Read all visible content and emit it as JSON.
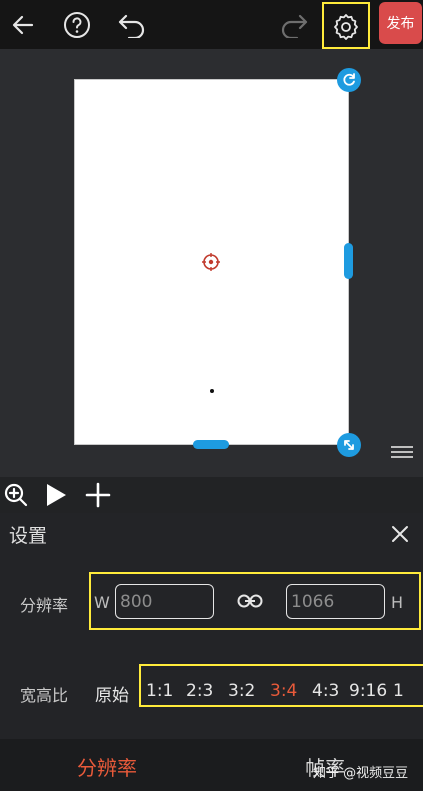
{
  "topbar": {
    "publish_label": "发布"
  },
  "panel": {
    "title": "设置",
    "resolution": {
      "label": "分辨率",
      "w_prefix": "W",
      "width_value": "800",
      "height_value": "1066",
      "h_suffix": "H"
    },
    "aspect": {
      "label": "宽高比",
      "options": [
        "原始",
        "1:1",
        "2:3",
        "3:2",
        "3:4",
        "4:3",
        "9:16",
        "1"
      ],
      "selected": "3:4"
    }
  },
  "bottom_tabs": {
    "tabs": [
      "分辨率",
      "帧率"
    ],
    "active": "分辨率"
  },
  "watermark": "知乎 @视频豆豆",
  "colors": {
    "accent_red": "#d94b4b",
    "selected_orange": "#e85a3a",
    "handle_blue": "#1e9be0",
    "highlight_yellow": "#ffeb3b"
  },
  "icons": [
    "back-arrow-icon",
    "help-icon",
    "undo-icon",
    "redo-icon",
    "settings-gear-icon",
    "rotate-icon",
    "resize-icon",
    "anchor-crosshair-icon",
    "zoom-in-icon",
    "play-icon",
    "plus-icon",
    "close-icon",
    "link-icon",
    "menu-lines-icon"
  ]
}
